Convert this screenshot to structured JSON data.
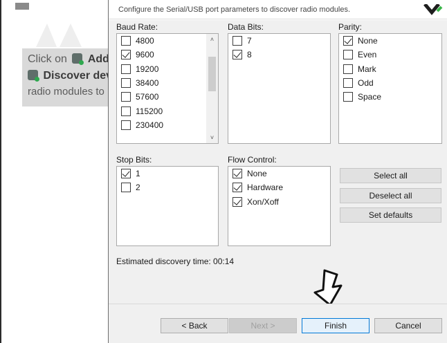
{
  "background": {
    "line1_prefix": "Click on",
    "line1_action": "Add",
    "line2_action": "Discover dev",
    "line3": "radio modules to"
  },
  "dialog": {
    "header_text": "Configure the Serial/USB port parameters to discover radio modules.",
    "baud_rate": {
      "label": "Baud Rate:",
      "options": [
        {
          "label": "4800",
          "checked": false
        },
        {
          "label": "9600",
          "checked": true
        },
        {
          "label": "19200",
          "checked": false
        },
        {
          "label": "38400",
          "checked": false
        },
        {
          "label": "57600",
          "checked": false
        },
        {
          "label": "115200",
          "checked": false
        },
        {
          "label": "230400",
          "checked": false
        }
      ]
    },
    "data_bits": {
      "label": "Data Bits:",
      "options": [
        {
          "label": "7",
          "checked": false
        },
        {
          "label": "8",
          "checked": true
        }
      ]
    },
    "parity": {
      "label": "Parity:",
      "options": [
        {
          "label": "None",
          "checked": true
        },
        {
          "label": "Even",
          "checked": false
        },
        {
          "label": "Mark",
          "checked": false
        },
        {
          "label": "Odd",
          "checked": false
        },
        {
          "label": "Space",
          "checked": false
        }
      ]
    },
    "stop_bits": {
      "label": "Stop Bits:",
      "options": [
        {
          "label": "1",
          "checked": true
        },
        {
          "label": "2",
          "checked": false
        }
      ]
    },
    "flow_control": {
      "label": "Flow Control:",
      "options": [
        {
          "label": "None",
          "checked": true
        },
        {
          "label": "Hardware",
          "checked": true
        },
        {
          "label": "Xon/Xoff",
          "checked": true
        }
      ]
    },
    "buttons": {
      "select_all": "Select all",
      "deselect_all": "Deselect all",
      "set_defaults": "Set defaults"
    },
    "estimated_time": "Estimated discovery time: 00:14",
    "footer": {
      "back": "< Back",
      "next": "Next >",
      "finish": "Finish",
      "cancel": "Cancel"
    }
  },
  "colors": {
    "dialog_bg": "#f0f0f0",
    "primary_border": "#0078d7",
    "annotation": "#111111"
  },
  "icons": [
    "add-radio-module-icon",
    "discover-devices-icon",
    "scroll-up-icon",
    "scroll-down-icon",
    "pointer-arrow-icon",
    "xbee-logo-icon"
  ]
}
